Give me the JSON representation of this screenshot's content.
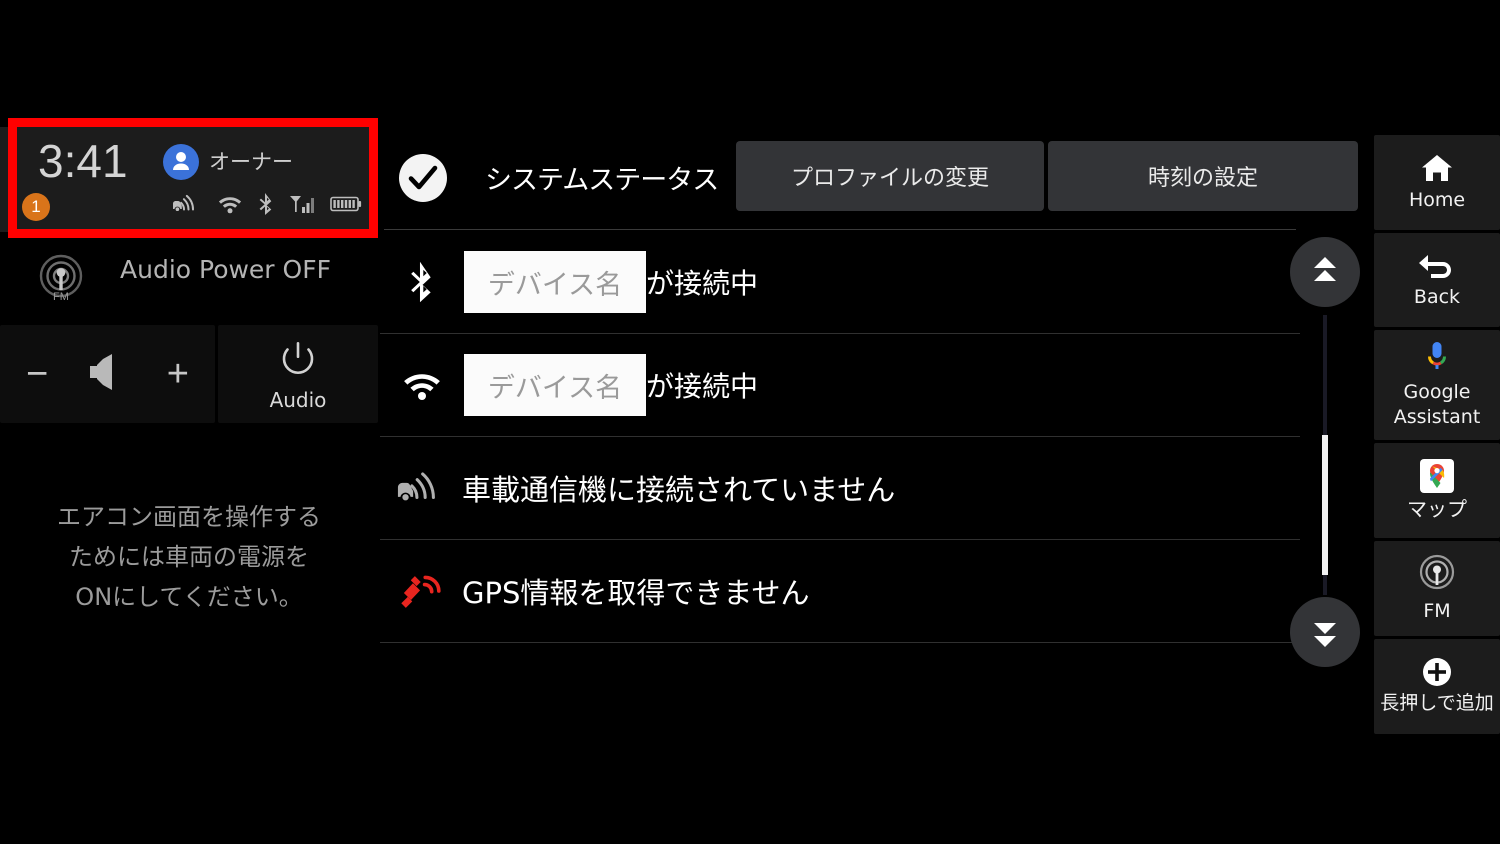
{
  "statusbar": {
    "time": "3:41",
    "owner_label": "オーナー",
    "notification_count": "1",
    "icons": [
      "telematics-icon",
      "wifi-icon",
      "bluetooth-icon",
      "cellular-signal-icon",
      "battery-icon"
    ],
    "avatar_icon": "user-avatar-icon",
    "highlight_color": "#ff0000"
  },
  "audio": {
    "source_icon": "fm-radio-icon",
    "power_label": "Audio Power OFF",
    "volume_minus": "−",
    "volume_plus": "+",
    "speaker_icon": "speaker-icon",
    "power_icon": "power-icon",
    "audio_button_label": "Audio"
  },
  "climate_message": {
    "line1": "エアコン画面を操作する",
    "line2": "ためには車両の電源を",
    "line3": "ONにしてください。"
  },
  "header": {
    "check_icon": "check-circle-icon",
    "title": "システムステータス",
    "profile_button": "プロファイルの変更",
    "clock_button": "時刻の設定"
  },
  "status_rows": [
    {
      "icon": "bluetooth-icon",
      "chip": "デバイス名",
      "text": "が接続中",
      "has_chip": true
    },
    {
      "icon": "wifi-icon",
      "chip": "デバイス名",
      "text": "が接続中",
      "has_chip": true
    },
    {
      "icon": "telematics-icon",
      "chip": "",
      "text": "車載通信機に接続されていません",
      "has_chip": false
    },
    {
      "icon": "gps-satellite-icon",
      "chip": "",
      "text": "GPS情報を取得できません",
      "has_chip": false
    }
  ],
  "scroll": {
    "up_icon": "scroll-up-icon",
    "down_icon": "scroll-down-icon"
  },
  "sidebar": {
    "items": [
      {
        "icon": "home-icon",
        "label": "Home"
      },
      {
        "icon": "back-arrow-icon",
        "label": "Back"
      },
      {
        "icon": "google-assistant-mic-icon",
        "label": "Google\nAssistant"
      },
      {
        "icon": "google-maps-icon",
        "label": "マップ"
      },
      {
        "icon": "fm-radio-icon",
        "label": "FM"
      },
      {
        "icon": "plus-circle-icon",
        "label": "長押しで追加"
      }
    ]
  },
  "colors": {
    "accent_blue": "#3b72d9",
    "badge_orange": "#d9741a",
    "gps_red": "#e8251f",
    "panel_dark": "#1c1c1c",
    "button_gray": "#333437",
    "chip_white": "#fbfbfb"
  }
}
